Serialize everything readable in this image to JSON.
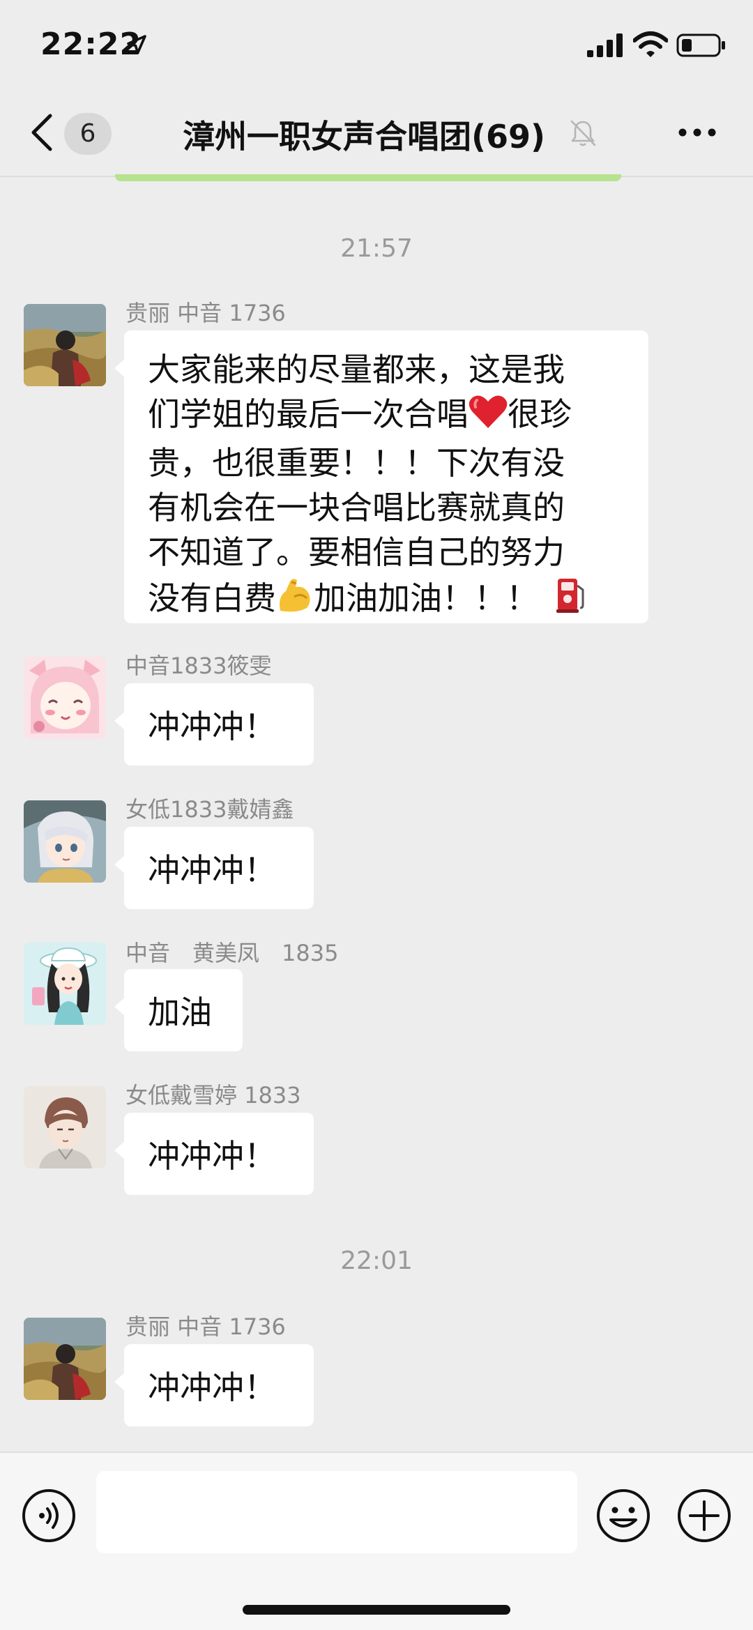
{
  "status": {
    "time": "22:22"
  },
  "nav": {
    "unread_count": "6",
    "title": "漳州一职女声合唱团(69)"
  },
  "messages": {
    "time1": "21:57",
    "m1": {
      "sender": "贵丽 中音 1736",
      "lines": [
        "大家能来的尽量都来，这是我",
        "们学姐的最后一次合唱",
        "很珍",
        "贵，也很重要！！！下次有没",
        "有机会在一块合唱比赛就真的",
        "不知道了。要相信自己的努力",
        "没有白费",
        "加油加油！！！"
      ]
    },
    "m2": {
      "sender": "中音1833筱雯",
      "text": "冲冲冲！"
    },
    "m3": {
      "sender": "女低1833戴婧鑫",
      "text": "冲冲冲！"
    },
    "m4": {
      "sender": "中音　黄美凤　1835",
      "text": "加油"
    },
    "m5": {
      "sender": "女低戴雪婷 1833",
      "text": "冲冲冲！"
    },
    "time2": "22:01",
    "m6": {
      "sender": "贵丽 中音 1736",
      "text": "冲冲冲！"
    }
  },
  "emojis": [
    "heart-emoji",
    "flexed-biceps-emoji",
    "fuel-pump-emoji"
  ],
  "colors": {
    "background": "#ededed",
    "bubble": "#ffffff",
    "green_strip": "#b7e28f",
    "heart": "#e0212e"
  },
  "icons": [
    "location-arrow-icon",
    "signal-icon",
    "wifi-icon",
    "battery-icon",
    "back-chevron-icon",
    "mute-bell-icon",
    "more-dots-icon",
    "voice-icon",
    "emoji-face-icon",
    "plus-icon"
  ]
}
